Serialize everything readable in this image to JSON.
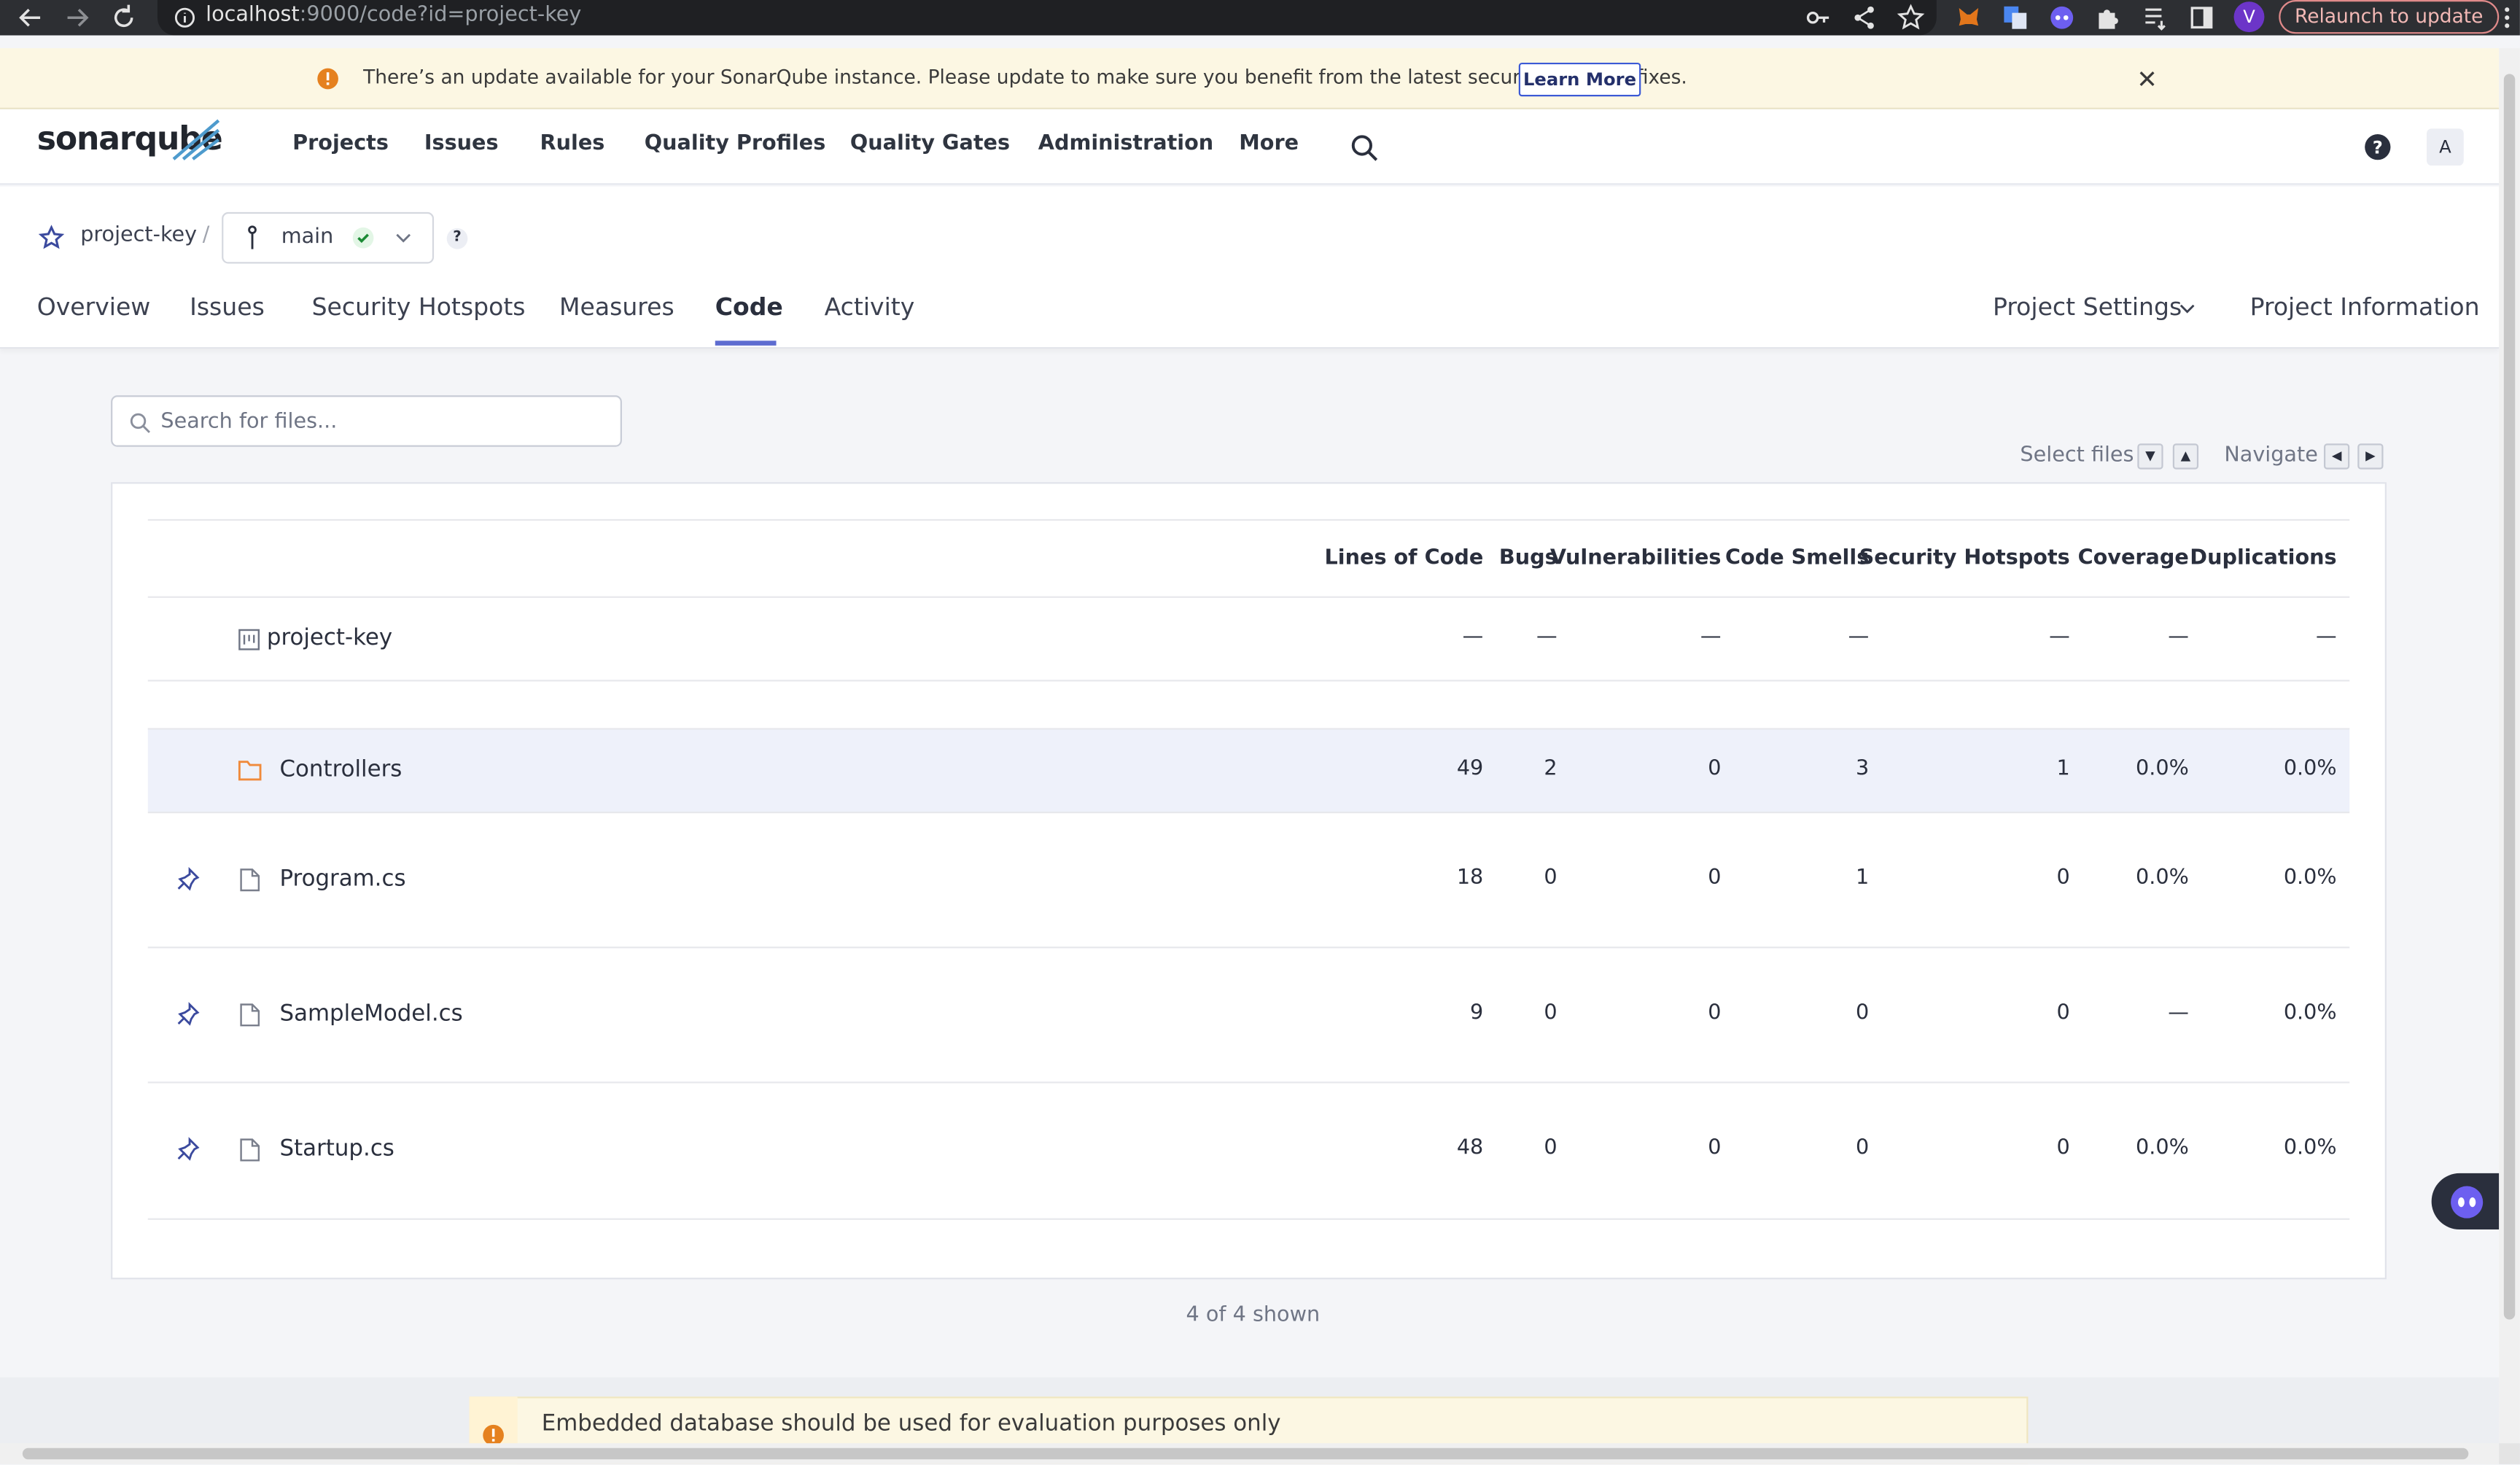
{
  "browser": {
    "url_host": "localhost",
    "url_rest": ":9000/code?id=project-key",
    "relaunch_label": "Relaunch to update",
    "profile_initial": "V"
  },
  "banner": {
    "message": "There’s an update available for your SonarQube instance. Please update to make sure you benefit from the latest security and bug fixes.",
    "learn_more": "Learn More"
  },
  "nav": {
    "logo": "sonarqube",
    "items": [
      "Projects",
      "Issues",
      "Rules",
      "Quality Profiles",
      "Quality Gates",
      "Administration",
      "More"
    ],
    "user_initial": "A"
  },
  "project": {
    "key": "project-key",
    "separator": "/",
    "branch": "main",
    "help": "?",
    "tabs": [
      "Overview",
      "Issues",
      "Security Hotspots",
      "Measures",
      "Code",
      "Activity"
    ],
    "active_tab": "Code",
    "settings_label": "Project Settings",
    "info_label": "Project Information"
  },
  "code": {
    "search_placeholder": "Search for files...",
    "select_files_label": "Select files",
    "navigate_label": "Navigate",
    "columns": [
      "Lines of Code",
      "Bugs",
      "Vulnerabilities",
      "Code Smells",
      "Security Hotspots",
      "Coverage",
      "Duplications"
    ],
    "root": {
      "name": "project-key",
      "values": [
        "—",
        "—",
        "—",
        "—",
        "—",
        "—",
        "—"
      ]
    },
    "rows": [
      {
        "name": "Controllers",
        "type": "folder",
        "values": [
          "49",
          "2",
          "0",
          "3",
          "1",
          "0.0%",
          "0.0%"
        ]
      },
      {
        "name": "Program.cs",
        "type": "file",
        "values": [
          "18",
          "0",
          "0",
          "1",
          "0",
          "0.0%",
          "0.0%"
        ]
      },
      {
        "name": "SampleModel.cs",
        "type": "file",
        "values": [
          "9",
          "0",
          "0",
          "0",
          "0",
          "—",
          "0.0%"
        ]
      },
      {
        "name": "Startup.cs",
        "type": "file",
        "values": [
          "48",
          "0",
          "0",
          "0",
          "0",
          "0.0%",
          "0.0%"
        ]
      }
    ],
    "shown": "4 of 4 shown"
  },
  "footer_warning": "Embedded database should be used for evaluation purposes only",
  "colors": {
    "accent": "#5d6cd0",
    "folder": "#f08a3b",
    "banner_bg": "#fcf7e3",
    "warning": "#e5811f"
  }
}
